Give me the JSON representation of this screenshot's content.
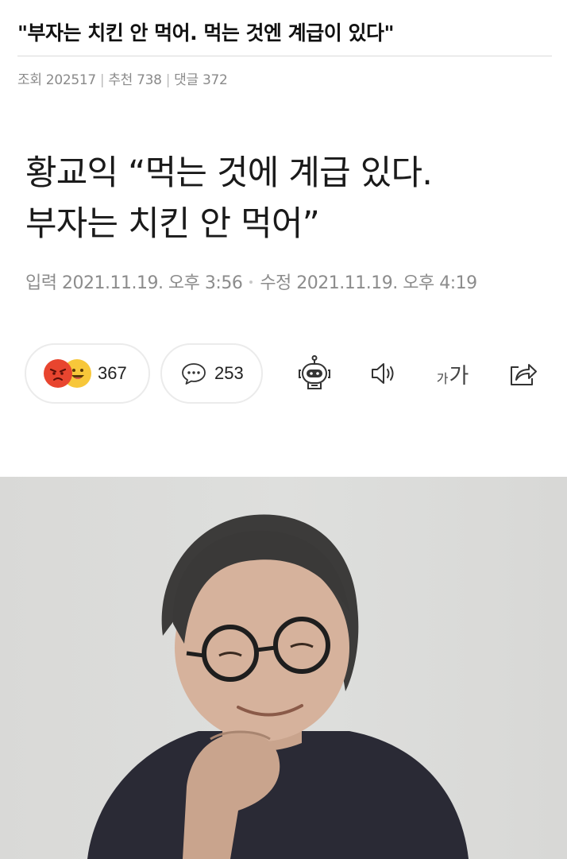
{
  "post": {
    "title": "\"부자는 치킨 안 먹어. 먹는 것엔 계급이 있다\"",
    "views_label": "조회",
    "views": "202517",
    "recommend_label": "추천",
    "recommend": "738",
    "comments_label": "댓글",
    "comments": "372",
    "separator": "|"
  },
  "article": {
    "headline_line1": "황교익 “먹는 것에 계급 있다.",
    "headline_line2": "부자는 치킨 안 먹어”",
    "input_label": "입력",
    "input_date": "2021.11.19. 오후 3:56",
    "edit_label": "수정",
    "edit_date": "2021.11.19. 오후 4:19"
  },
  "actions": {
    "reaction_count": "367",
    "comment_count": "253",
    "font_small": "가",
    "font_large": "가",
    "icons": [
      "angry-emoji-icon",
      "smile-emoji-icon",
      "speech-bubble-icon",
      "robot-icon",
      "speaker-icon",
      "share-icon"
    ]
  },
  "colors": {
    "angry": "#e8452f",
    "happy": "#f7c73a",
    "meta_text": "#8a8a8a",
    "photo_bg": "#dcdcda"
  }
}
